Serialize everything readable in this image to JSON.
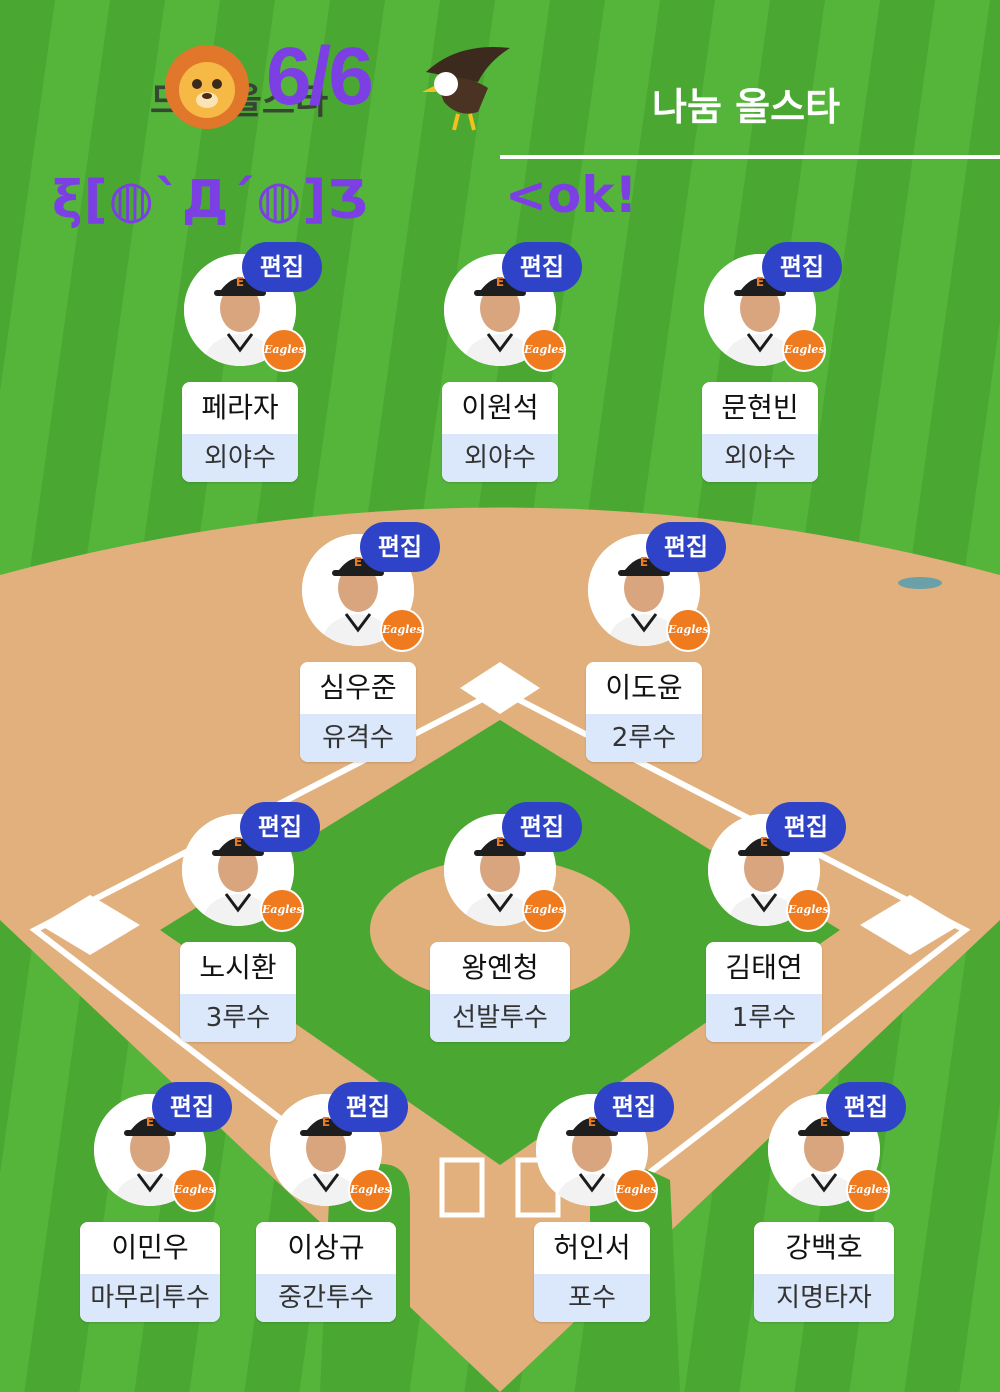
{
  "header": {
    "date": "6/6",
    "team_left": "드림 올스타",
    "team_right": "나눔 올스타",
    "emoticon": "ξ[◍`Д´◍]Ʒ",
    "ok_text": "<ok!",
    "icons": [
      "lion-emoji-icon",
      "eagle-emoji-icon"
    ]
  },
  "edit_label": "편집",
  "team_logo_text": "Eagles",
  "players": [
    {
      "name": "페라자",
      "position": "외야수"
    },
    {
      "name": "이원석",
      "position": "외야수"
    },
    {
      "name": "문현빈",
      "position": "외야수"
    },
    {
      "name": "심우준",
      "position": "유격수"
    },
    {
      "name": "이도윤",
      "position": "2루수"
    },
    {
      "name": "노시환",
      "position": "3루수"
    },
    {
      "name": "왕옌청",
      "position": "선발투수"
    },
    {
      "name": "김태연",
      "position": "1루수"
    },
    {
      "name": "이민우",
      "position": "마무리투수"
    },
    {
      "name": "이상규",
      "position": "중간투수"
    },
    {
      "name": "허인서",
      "position": "포수"
    },
    {
      "name": "강백호",
      "position": "지명타자"
    }
  ],
  "colors": {
    "grass": "#4aa832",
    "grass_stripe": "#56b63c",
    "dirt": "#e2b07c",
    "edit_button": "#2f43c8",
    "position_bg": "#dbe7fb",
    "accent_purple": "#7b3fe4",
    "team_orange": "#f07a1e"
  }
}
